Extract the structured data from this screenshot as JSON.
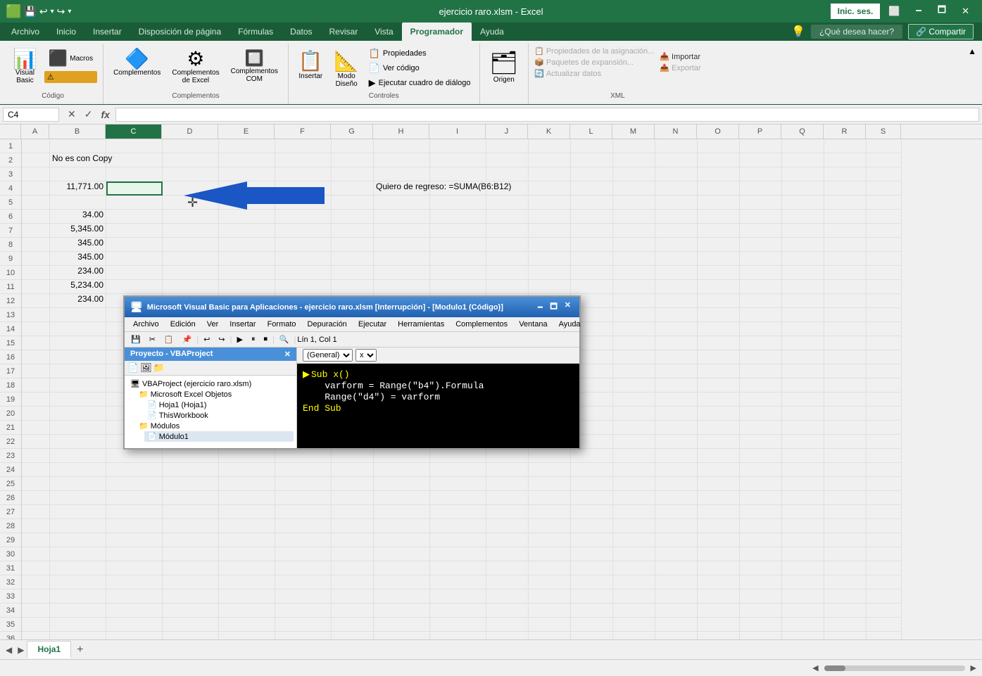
{
  "titleBar": {
    "title": "ejercicio raro.xlsm - Excel",
    "inicBtn": "Inic. ses.",
    "minBtn": "🗕",
    "maxBtn": "🗖",
    "closeBtn": "✕"
  },
  "quickAccess": {
    "save": "💾",
    "undo": "↩",
    "redo": "↪"
  },
  "ribbonTabs": [
    {
      "id": "archivo",
      "label": "Archivo"
    },
    {
      "id": "inicio",
      "label": "Inicio"
    },
    {
      "id": "insertar",
      "label": "Insertar"
    },
    {
      "id": "disposicion",
      "label": "Disposición de página"
    },
    {
      "id": "formulas",
      "label": "Fórmulas"
    },
    {
      "id": "datos",
      "label": "Datos"
    },
    {
      "id": "revisar",
      "label": "Revisar"
    },
    {
      "id": "vista",
      "label": "Vista"
    },
    {
      "id": "programador",
      "label": "Programador",
      "active": true
    },
    {
      "id": "ayuda",
      "label": "Ayuda"
    }
  ],
  "ribbon": {
    "groups": {
      "codigo": {
        "label": "Código",
        "items": [
          {
            "id": "visual-basic",
            "icon": "📊",
            "label": "Visual\nBasic"
          },
          {
            "id": "macros",
            "icon": "⬛",
            "label": "Macros"
          }
        ]
      },
      "complementos": {
        "label": "Complementos",
        "items": [
          {
            "id": "comp1",
            "icon": "🔷",
            "label": "Complementos"
          },
          {
            "id": "comp2",
            "icon": "⚙",
            "label": "Complementos\nde Excel"
          },
          {
            "id": "comp3",
            "icon": "🔲",
            "label": "Complementos\nCOM"
          }
        ]
      },
      "controles": {
        "label": "Controles",
        "items": [
          {
            "id": "insertar-ctrl",
            "icon": "📋",
            "label": "Insertar"
          },
          {
            "id": "modo-diseno",
            "icon": "📐",
            "label": "Modo\nDiseño"
          }
        ],
        "subItems": [
          {
            "id": "propiedades",
            "icon": "📋",
            "label": "Propiedades"
          },
          {
            "id": "ver-codigo",
            "icon": "📄",
            "label": "Ver código"
          },
          {
            "id": "ejecutar-cuadro",
            "icon": "▶",
            "label": "Ejecutar cuadro de diálogo"
          }
        ]
      },
      "origen": {
        "label": "Origen",
        "item": {
          "id": "origen",
          "icon": "🗂",
          "label": "Origen"
        }
      },
      "xml": {
        "label": "XML",
        "items": [
          {
            "id": "prop-asign",
            "label": "Propiedades de la asignación...",
            "enabled": false
          },
          {
            "id": "paquetes",
            "label": "Paquetes de expansión...",
            "enabled": false
          },
          {
            "id": "actualizar",
            "label": "Actualizar datos",
            "enabled": false
          },
          {
            "id": "importar",
            "label": "Importar",
            "enabled": true
          },
          {
            "id": "exportar",
            "label": "Exportar",
            "enabled": false
          }
        ]
      }
    }
  },
  "formulaBar": {
    "cellRef": "C4",
    "cancelIcon": "✕",
    "confirmIcon": "✓",
    "funcIcon": "fx",
    "formula": ""
  },
  "spreadsheet": {
    "columns": [
      "A",
      "B",
      "C",
      "D",
      "E",
      "F",
      "G",
      "H",
      "I",
      "J",
      "K",
      "L",
      "M",
      "N",
      "O",
      "P",
      "Q",
      "R",
      "S"
    ],
    "rows": 38,
    "cells": {
      "B2": "No es con Copy",
      "B4": "11,771.00",
      "B6": "34.00",
      "B7": "5,345.00",
      "B8": "345.00",
      "B9": "345.00",
      "B10": "234.00",
      "B11": "5,234.00",
      "B12": "234.00",
      "H4": "Quiero de regreso: =SUMA(B6:B12)"
    },
    "selectedCell": "C4",
    "arrow": {
      "text": "←",
      "desc": "blue arrow pointing left from E4 area to C4"
    }
  },
  "sheetTabs": [
    {
      "id": "hoja1",
      "label": "Hoja1",
      "active": true
    }
  ],
  "statusBar": {
    "left": "",
    "right": ""
  },
  "vbaEditor": {
    "title": "Microsoft Visual Basic para Aplicaciones - ejercicio raro.xlsm [Interrupción] - [Modulo1 (Código)]",
    "menuItems": [
      "Archivo",
      "Edición",
      "Ver",
      "Insertar",
      "Formato",
      "Depuración",
      "Ejecutar",
      "Herramientas",
      "Complementos",
      "Ventana",
      "Ayuda"
    ],
    "projectPanel": {
      "title": "Proyecto - VBAProject",
      "tree": [
        {
          "level": 0,
          "icon": "🖥",
          "label": "VBAProject (ejercicio raro.xlsm)",
          "bold": true
        },
        {
          "level": 1,
          "icon": "📁",
          "label": "Microsoft Excel Objetos"
        },
        {
          "level": 2,
          "icon": "📄",
          "label": "Hoja1 (Hoja1)"
        },
        {
          "level": 2,
          "icon": "📄",
          "label": "ThisWorkbook"
        },
        {
          "level": 1,
          "icon": "📁",
          "label": "Módulos"
        },
        {
          "level": 2,
          "icon": "📄",
          "label": "Módulo1"
        }
      ]
    },
    "codeHeader": "(General)",
    "code": [
      {
        "text": "Sub x()",
        "color": "yellow"
      },
      {
        "text": "    varform = Range(\"b4\").Formula",
        "color": "white"
      },
      {
        "text": "    Range(\"d4\") = varform",
        "color": "white"
      },
      {
        "text": "End Sub",
        "color": "yellow"
      }
    ],
    "statusBar": "Lín 1, Col 1"
  },
  "colors": {
    "excelGreen": "#217346",
    "ribbonBg": "#f0f0f0",
    "accent": "#4a90d9",
    "cellBorder": "#e0e0e0",
    "selectedCell": "#217346"
  }
}
